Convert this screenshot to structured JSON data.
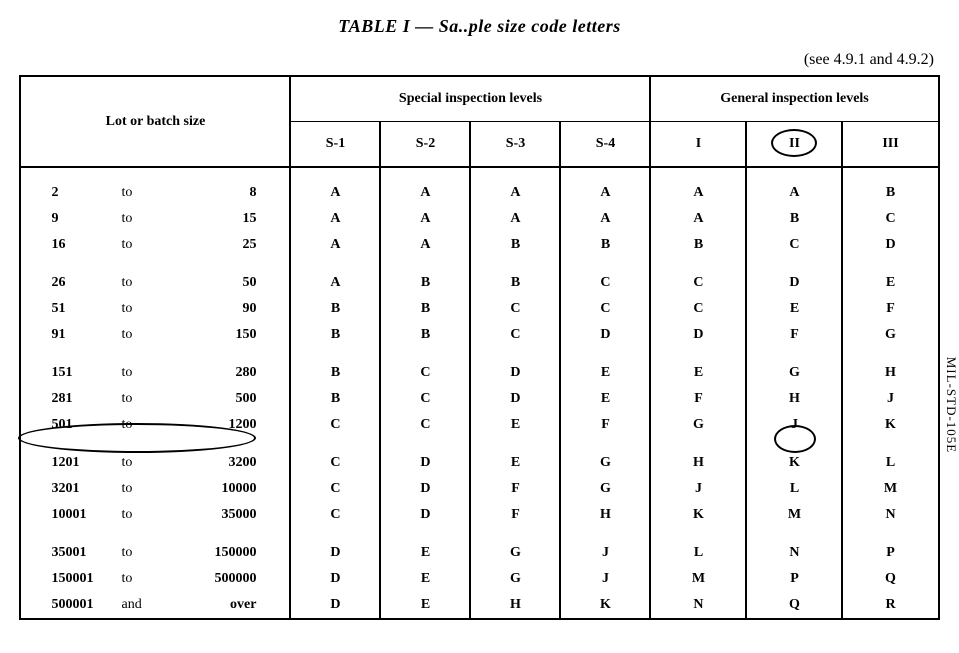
{
  "title": "TABLE I — Sa..ple size code letters",
  "see_ref": "(see 4.9.1 and 4.9.2)",
  "side_label": "MIL-STD-105E",
  "headers": {
    "lot": "Lot or batch size",
    "special": "Special inspection levels",
    "general": "General inspection levels",
    "sub": [
      "S-1",
      "S-2",
      "S-3",
      "S-4",
      "I",
      "II",
      "III"
    ]
  },
  "groups": [
    [
      {
        "from": "2",
        "to": "to",
        "tox": "8",
        "v": [
          "A",
          "A",
          "A",
          "A",
          "A",
          "A",
          "B"
        ]
      },
      {
        "from": "9",
        "to": "to",
        "tox": "15",
        "v": [
          "A",
          "A",
          "A",
          "A",
          "A",
          "B",
          "C"
        ]
      },
      {
        "from": "16",
        "to": "to",
        "tox": "25",
        "v": [
          "A",
          "A",
          "B",
          "B",
          "B",
          "C",
          "D"
        ]
      }
    ],
    [
      {
        "from": "26",
        "to": "to",
        "tox": "50",
        "v": [
          "A",
          "B",
          "B",
          "C",
          "C",
          "D",
          "E"
        ]
      },
      {
        "from": "51",
        "to": "to",
        "tox": "90",
        "v": [
          "B",
          "B",
          "C",
          "C",
          "C",
          "E",
          "F"
        ]
      },
      {
        "from": "91",
        "to": "to",
        "tox": "150",
        "v": [
          "B",
          "B",
          "C",
          "D",
          "D",
          "F",
          "G"
        ]
      }
    ],
    [
      {
        "from": "151",
        "to": "to",
        "tox": "280",
        "v": [
          "B",
          "C",
          "D",
          "E",
          "E",
          "G",
          "H"
        ]
      },
      {
        "from": "281",
        "to": "to",
        "tox": "500",
        "v": [
          "B",
          "C",
          "D",
          "E",
          "F",
          "H",
          "J"
        ]
      },
      {
        "from": "501",
        "to": "to",
        "tox": "1200",
        "v": [
          "C",
          "C",
          "E",
          "F",
          "G",
          "J",
          "K"
        ]
      }
    ],
    [
      {
        "from": "1201",
        "to": "to",
        "tox": "3200",
        "v": [
          "C",
          "D",
          "E",
          "G",
          "H",
          "K",
          "L"
        ]
      },
      {
        "from": "3201",
        "to": "to",
        "tox": "10000",
        "v": [
          "C",
          "D",
          "F",
          "G",
          "J",
          "L",
          "M"
        ]
      },
      {
        "from": "10001",
        "to": "to",
        "tox": "35000",
        "v": [
          "C",
          "D",
          "F",
          "H",
          "K",
          "M",
          "N"
        ]
      }
    ],
    [
      {
        "from": "35001",
        "to": "to",
        "tox": "150000",
        "v": [
          "D",
          "E",
          "G",
          "J",
          "L",
          "N",
          "P"
        ]
      },
      {
        "from": "150001",
        "to": "to",
        "tox": "500000",
        "v": [
          "D",
          "E",
          "G",
          "J",
          "M",
          "P",
          "Q"
        ]
      },
      {
        "from": "500001",
        "to": "and",
        "tox": "over",
        "v": [
          "D",
          "E",
          "H",
          "K",
          "N",
          "Q",
          "R"
        ]
      }
    ]
  ],
  "chart_data": {
    "type": "table",
    "title": "TABLE I — Sample size code letters",
    "note": "see 4.9.1 and 4.9.2",
    "columns": [
      "Lot or batch size (from)",
      "Lot or batch size (to)",
      "S-1",
      "S-2",
      "S-3",
      "S-4",
      "I",
      "II",
      "III"
    ],
    "rows": [
      [
        "2",
        "8",
        "A",
        "A",
        "A",
        "A",
        "A",
        "A",
        "B"
      ],
      [
        "9",
        "15",
        "A",
        "A",
        "A",
        "A",
        "A",
        "B",
        "C"
      ],
      [
        "16",
        "25",
        "A",
        "A",
        "B",
        "B",
        "B",
        "C",
        "D"
      ],
      [
        "26",
        "50",
        "A",
        "B",
        "B",
        "C",
        "C",
        "D",
        "E"
      ],
      [
        "51",
        "90",
        "B",
        "B",
        "C",
        "C",
        "C",
        "E",
        "F"
      ],
      [
        "91",
        "150",
        "B",
        "B",
        "C",
        "D",
        "D",
        "F",
        "G"
      ],
      [
        "151",
        "280",
        "B",
        "C",
        "D",
        "E",
        "E",
        "G",
        "H"
      ],
      [
        "281",
        "500",
        "B",
        "C",
        "D",
        "E",
        "F",
        "H",
        "J"
      ],
      [
        "501",
        "1200",
        "C",
        "C",
        "E",
        "F",
        "G",
        "J",
        "K"
      ],
      [
        "1201",
        "3200",
        "C",
        "D",
        "E",
        "G",
        "H",
        "K",
        "L"
      ],
      [
        "3201",
        "10000",
        "C",
        "D",
        "F",
        "G",
        "J",
        "L",
        "M"
      ],
      [
        "10001",
        "35000",
        "C",
        "D",
        "F",
        "H",
        "K",
        "M",
        "N"
      ],
      [
        "35001",
        "150000",
        "D",
        "E",
        "G",
        "J",
        "L",
        "N",
        "P"
      ],
      [
        "150001",
        "500000",
        "D",
        "E",
        "G",
        "J",
        "M",
        "P",
        "Q"
      ],
      [
        "500001",
        "and over",
        "D",
        "E",
        "H",
        "K",
        "N",
        "Q",
        "R"
      ]
    ],
    "highlighted": {
      "column": "II",
      "row_range": "501 to 1200",
      "value": "J"
    }
  }
}
